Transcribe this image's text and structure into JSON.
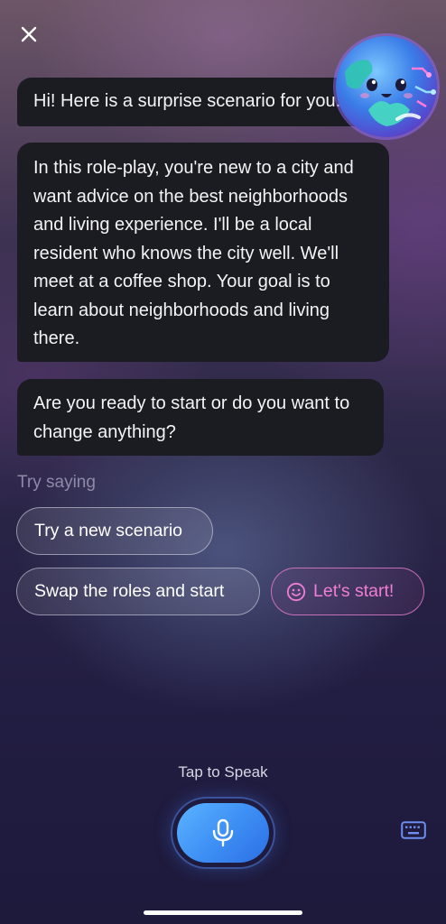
{
  "header": {
    "close_icon": "close-icon",
    "avatar_icon": "globe-mascot-icon"
  },
  "messages": [
    {
      "text": "Hi! Here is a surprise scenario for you."
    },
    {
      "text": "In this role-play, you're new to a city and want advice on the best neighborhoods and living experience. I'll be a local resident who knows the city well. We'll meet at a coffee shop. Your goal is to learn about neighborhoods and living there."
    },
    {
      "text": "Are you ready to start or do you want to change anything?"
    }
  ],
  "suggestions": {
    "label": "Try saying",
    "items": [
      {
        "label": "Try a new scenario"
      },
      {
        "label": "Swap the roles and start"
      },
      {
        "label": "Let's start!",
        "icon": "smile-icon"
      }
    ]
  },
  "footer": {
    "tap_label": "Tap to Speak",
    "mic_icon": "microphone-icon",
    "keyboard_icon": "keyboard-icon"
  },
  "colors": {
    "bubble_bg": "#1b1b22",
    "accent_pink": "#f07ed4",
    "mic_blue": "#3c8df4"
  }
}
